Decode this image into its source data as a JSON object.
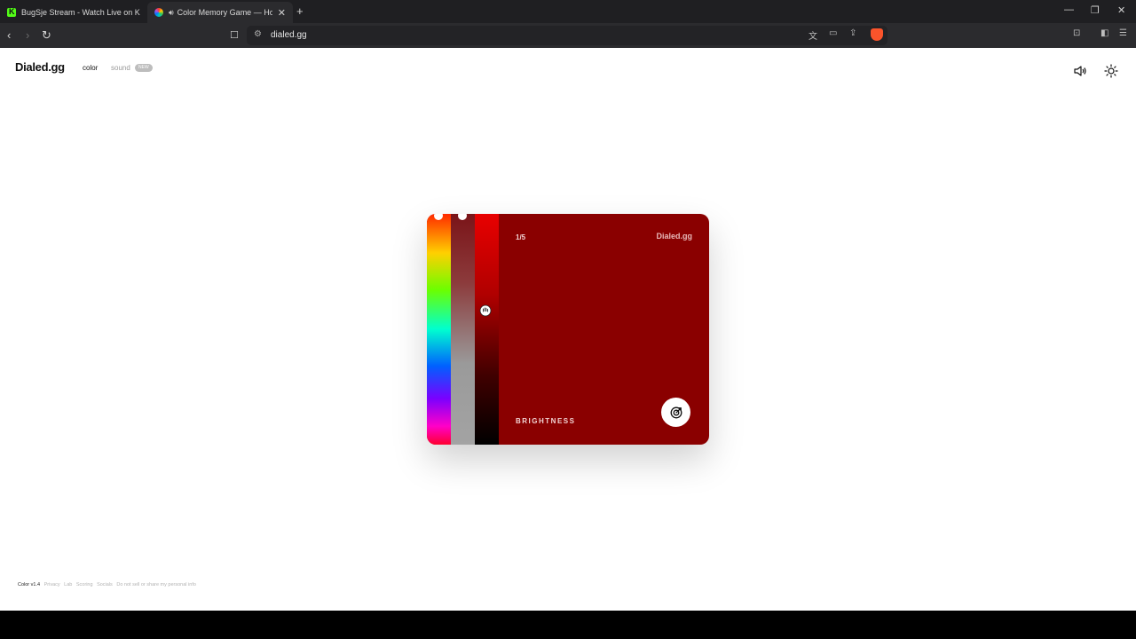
{
  "browser": {
    "tabs": [
      {
        "title": "BugSje Stream - Watch Live on Kick",
        "active": false,
        "favicon": "kick-logo-icon"
      },
      {
        "title": "Color Memory Game — How",
        "active": true,
        "favicon": "color-wheel-icon",
        "audio": true
      }
    ],
    "new_tab": "+",
    "url": "dialed.gg"
  },
  "header": {
    "logo": "Dialed.gg",
    "nav": {
      "color": "color",
      "sound": "sound",
      "sound_badge": "NEW"
    }
  },
  "game": {
    "counter": "1/5",
    "brand": "Dialed.gg",
    "slider_label": "BRIGHTNESS",
    "color": "#8a0000",
    "brightness_level": 0.58
  },
  "footer": {
    "items": [
      "Color v1.4",
      "Privacy",
      "Lab",
      "Scoring",
      "Socials",
      "Do not sell or share my personal info"
    ]
  },
  "colors": {
    "accent": "#8a0000",
    "page_bg": "#ffffff"
  }
}
